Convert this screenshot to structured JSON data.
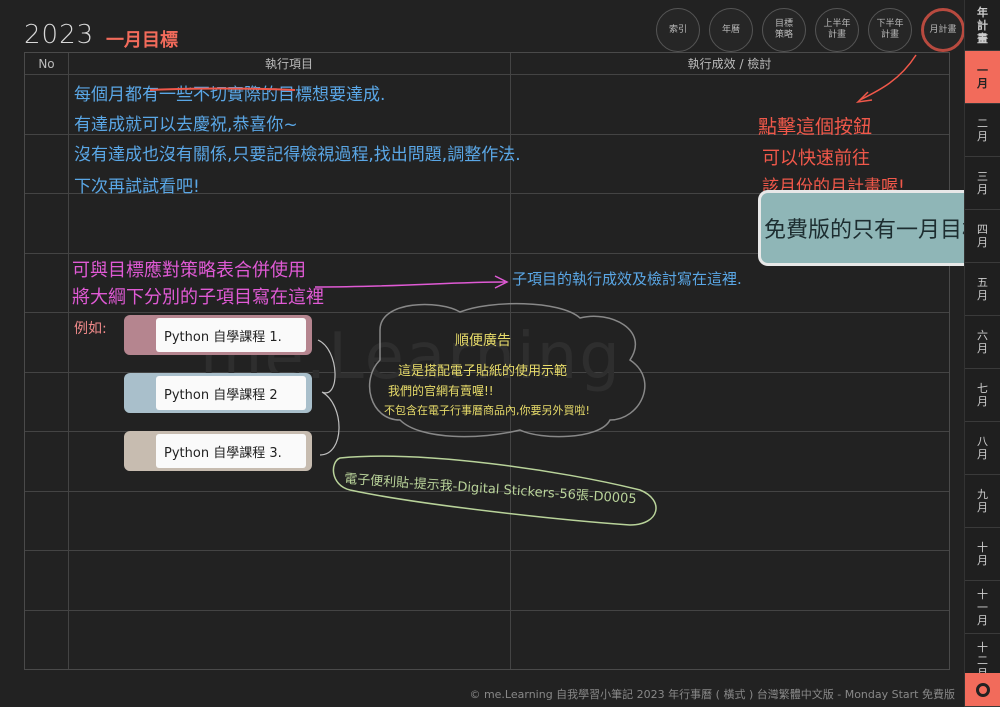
{
  "header": {
    "year": "2023",
    "title": "一月目標"
  },
  "nav": [
    {
      "label": "索引",
      "name": "nav-index-button"
    },
    {
      "label": "年曆",
      "name": "nav-calendar-button"
    },
    {
      "label": "目標\n策略",
      "name": "nav-strategy-button"
    },
    {
      "label": "上半年\n計畫",
      "name": "nav-first-half-button"
    },
    {
      "label": "下半年\n計畫",
      "name": "nav-second-half-button"
    },
    {
      "label": "月計畫",
      "name": "nav-monthly-plan-button"
    }
  ],
  "table": {
    "col_no": "No",
    "col_item": "執行項目",
    "col_result": "執行成效 / 檢討"
  },
  "notes": {
    "line1": "每個月都有一些不切實際的目標想要達成.",
    "line2": "有達成就可以去慶祝,恭喜你~",
    "line3": "沒有達成也沒有關係,只要記得檢視過程,找出問題,調整作法.",
    "line4": "下次再試試看吧!",
    "pink1": "可與目標應對策略表合併使用",
    "pink2": "將大綱下分別的子項目寫在這裡",
    "arrow_note": "子項目的執行成效及檢討寫在這裡.",
    "example": "例如:",
    "red1": "點擊這個按鈕",
    "red2": "可以快速前往",
    "red3": "該月份的月計畫喔!",
    "free": "免費版的只有一月目標",
    "ad_title": "順便廣告",
    "ad1": "這是搭配電子貼紙的使用示範",
    "ad2": "我們的官網有賣喔!!",
    "ad3": "不包含在電子行事曆商品內,你要另外買啦!",
    "ad_product": "電子便利貼-提示我-Digital Stickers-56張-D0005"
  },
  "stickers": [
    {
      "label": "Python 自學課程 1.",
      "color": "#b5858f"
    },
    {
      "label": "Python 自學課程 2",
      "color": "#a9bfcb"
    },
    {
      "label": "Python 自學課程 3.",
      "color": "#c7bcb0"
    }
  ],
  "side": {
    "year": "年\n計\n畫",
    "months": [
      "一\n月",
      "二\n月",
      "三\n月",
      "四\n月",
      "五\n月",
      "六\n月",
      "七\n月",
      "八\n月",
      "九\n月",
      "十\n月",
      "十\n一\n月",
      "十\n二\n月"
    ]
  },
  "footer": "© me.Learning 自我學習小筆記 2023 年行事曆 ( 橫式 ) 台灣繁體中文版 - Monday Start 免費版",
  "watermark": "me.Learning",
  "colors": {
    "accent": "#f26b5b",
    "bg": "#222222"
  }
}
